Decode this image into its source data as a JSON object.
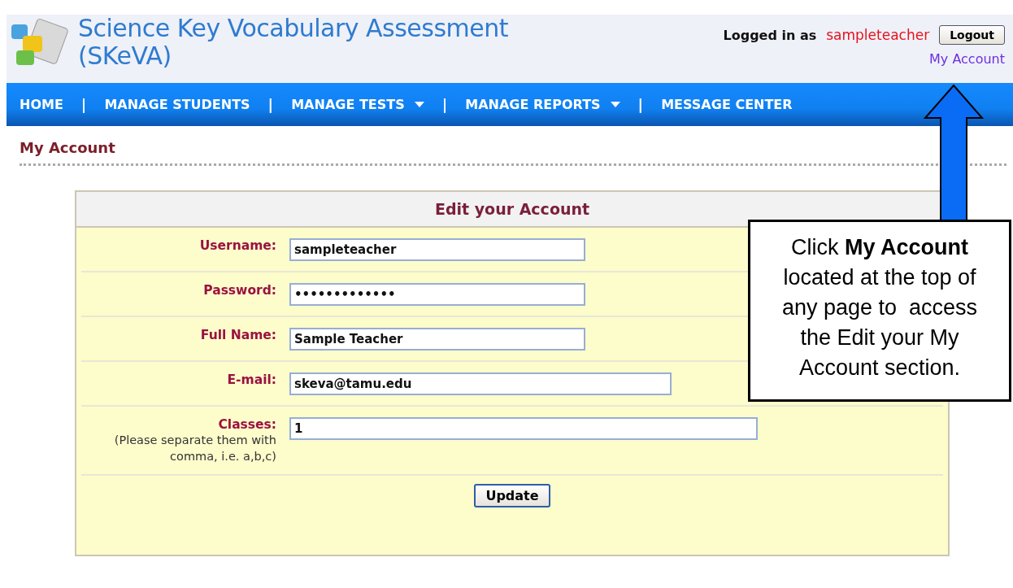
{
  "header": {
    "title_line_1": "Science Key Vocabulary Assessment",
    "title_line_2": "(SKeVA)",
    "logged_in_label": "Logged in as",
    "username": "sampleteacher",
    "logout_button": "Logout",
    "account_link": "My Account"
  },
  "nav": [
    {
      "label": "HOME",
      "dropdown": false
    },
    {
      "label": "MANAGE STUDENTS",
      "dropdown": false
    },
    {
      "label": "MANAGE TESTS",
      "dropdown": true
    },
    {
      "label": "MANAGE REPORTS",
      "dropdown": true
    },
    {
      "label": "MESSAGE CENTER",
      "dropdown": false
    }
  ],
  "nav_separator": "|",
  "page_title": "My Account",
  "form": {
    "title": "Edit your Account",
    "fields": [
      {
        "label": "Username:",
        "value": "sampleteacher"
      },
      {
        "label": "Password:",
        "value": "•••••••••••••"
      },
      {
        "label": "Full Name:",
        "value": "Sample Teacher"
      },
      {
        "label": "E-mail:",
        "value": "skeva@tamu.edu"
      },
      {
        "label": "Classes:",
        "hint": "(Please separate them with comma, i.e. a,b,c)",
        "value": "1"
      }
    ],
    "submit_button": "Update"
  },
  "callout": {
    "text": "Click **My Account** located at the top of any page to  access the Edit your My Account section."
  }
}
